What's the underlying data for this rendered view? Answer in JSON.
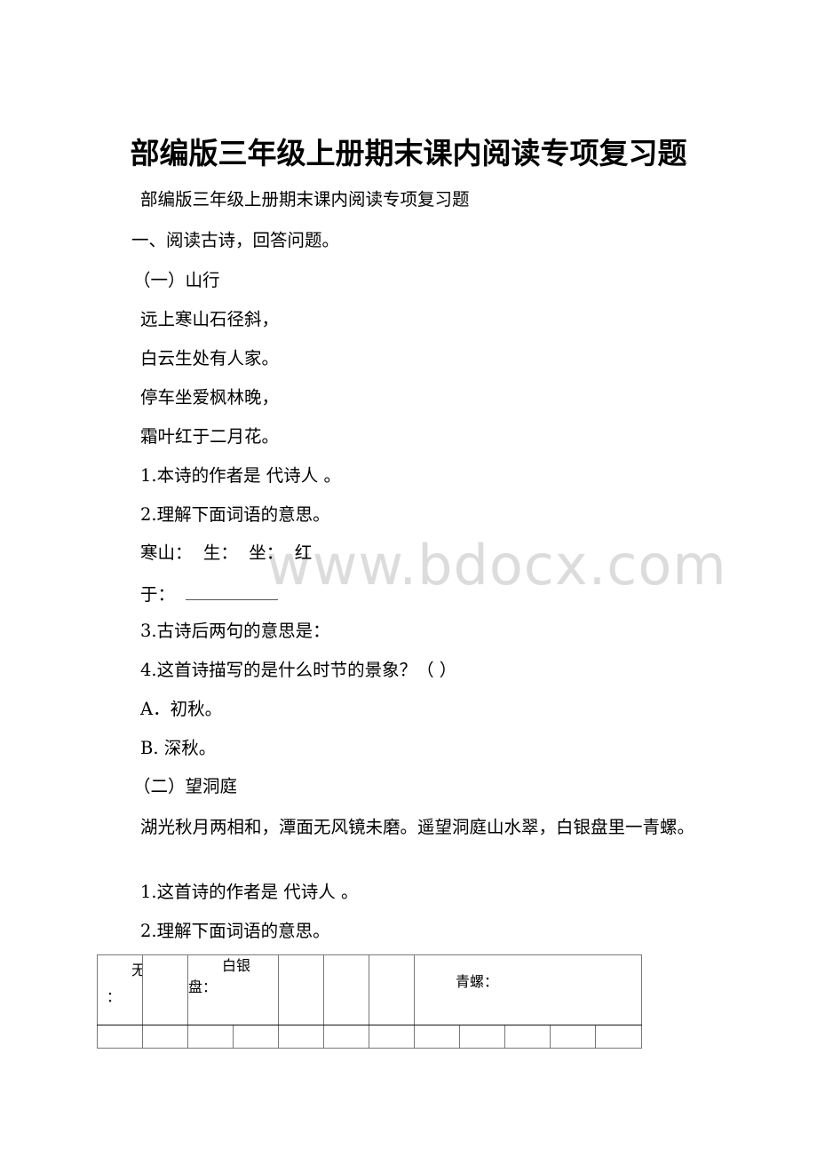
{
  "document": {
    "title": "部编版三年级上册期末课内阅读专项复习题",
    "subtitle": "部编版三年级上册期末课内阅读专项复习题",
    "section1_heading": "一、阅读古诗，回答问题。",
    "poem1": {
      "heading": "（一）山行",
      "lines": [
        "远上寒山石径斜，",
        "白云生处有人家。",
        "停车坐爱枫林晚，",
        "霜叶红于二月花。"
      ],
      "questions": {
        "q1": "1.本诗的作者是 代诗人 。",
        "q2": "2.理解下面词语的意思。",
        "q2_terms": "寒山：  生：  坐：  红",
        "q2_terms_cont": "于：",
        "q3": "3.古诗后两句的意思是：",
        "q4": "4.这首诗描写的是什么时节的景象？（ ）",
        "option_a": "A．初秋。",
        "option_b": "B. 深秋。"
      }
    },
    "poem2": {
      "heading": "（二）望洞庭",
      "text": "湖光秋月两相和，潭面无风镜未磨。遥望洞庭山水翠，白银盘里一青螺。",
      "questions": {
        "q1": "1.这首诗的作者是 代诗人 。",
        "q2": "2.理解下面词语的意思。"
      },
      "table": {
        "cell1_clipped": "无",
        "cell1_colon": "：",
        "silver_plate_line1": "白银",
        "silver_plate_line2": "盘：",
        "green_snail": "青螺："
      }
    },
    "watermark": "www.bdocx.com"
  }
}
